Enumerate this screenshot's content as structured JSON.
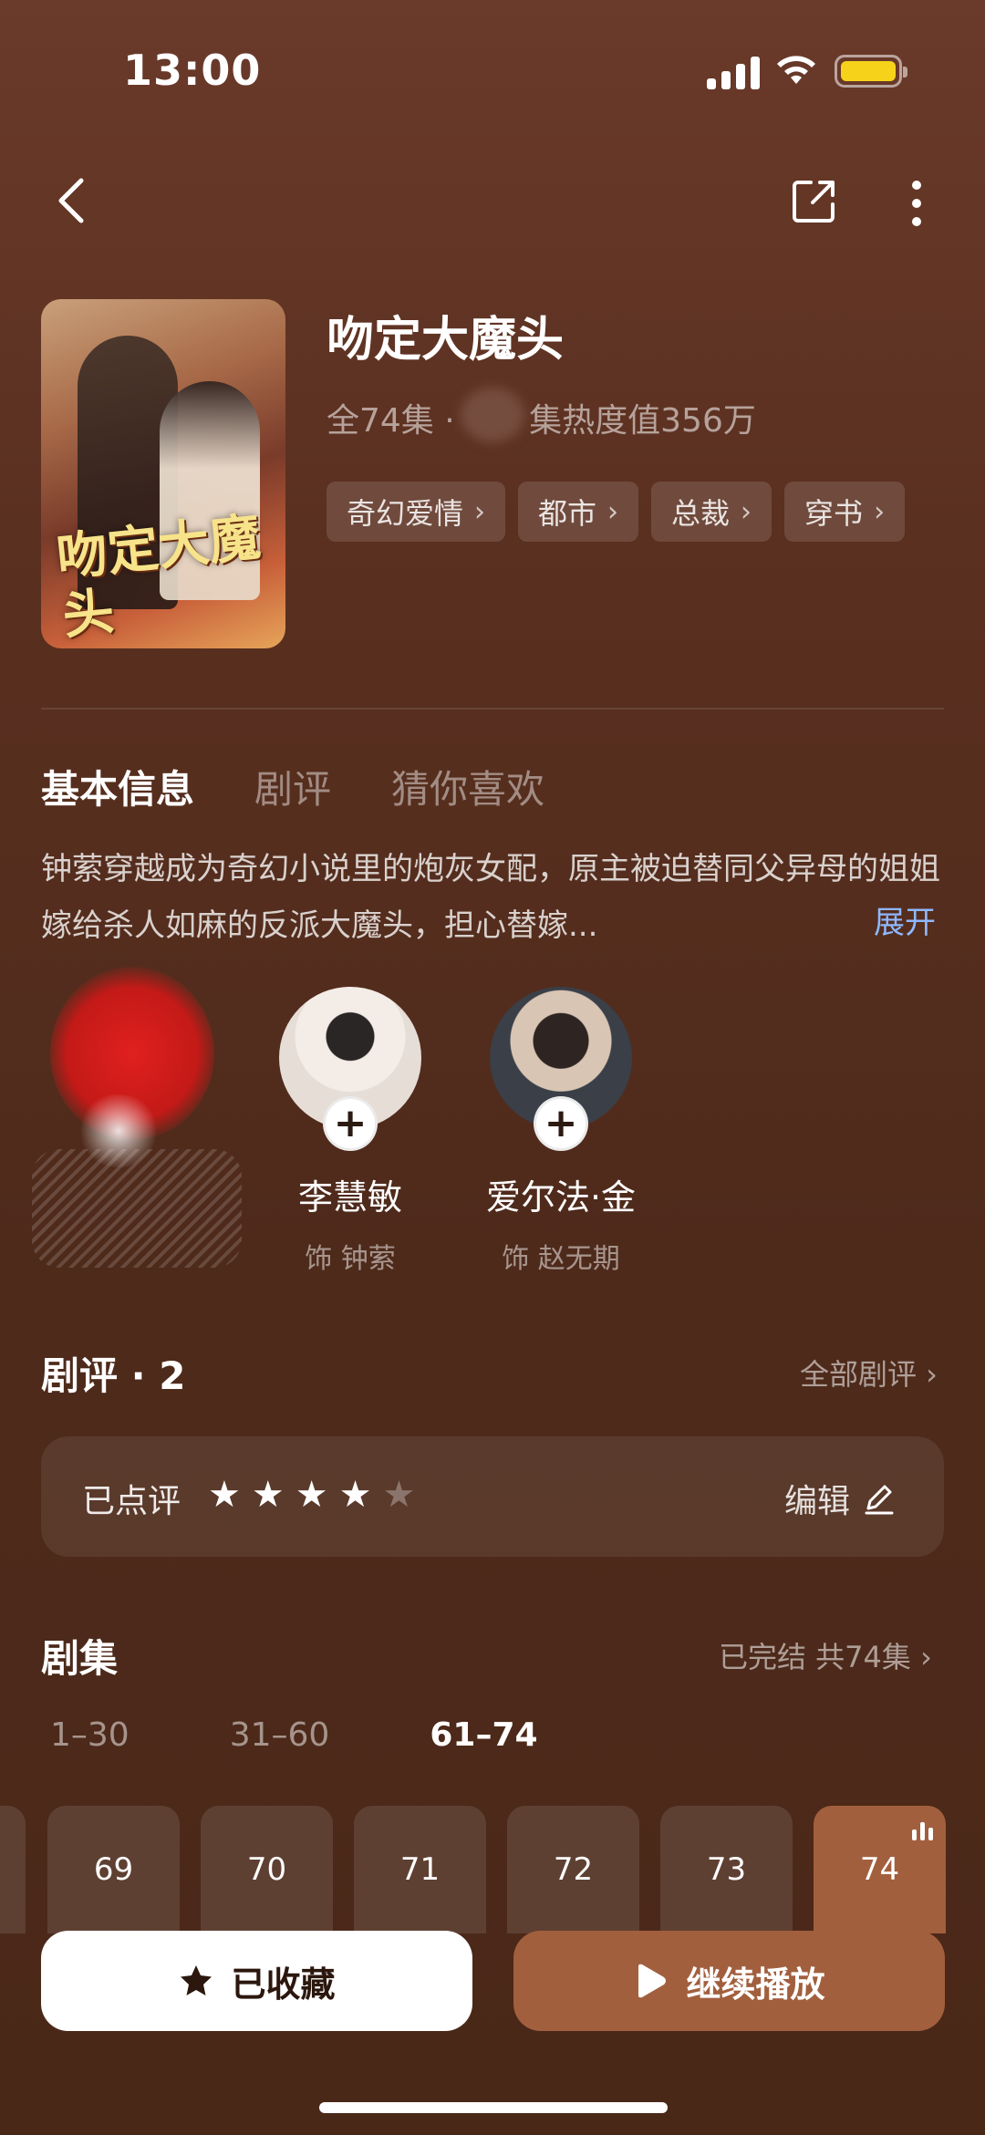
{
  "status_bar": {
    "time": "13:00"
  },
  "show": {
    "title": "吻定大魔头",
    "cover_title": "吻定大魔头",
    "meta": "全74集 · ",
    "meta_heat": "集热度值356万",
    "tags": [
      "奇幻爱情",
      "都市",
      "总裁",
      "穿书"
    ]
  },
  "tabs": [
    {
      "label": "基本信息",
      "active": true
    },
    {
      "label": "剧评",
      "active": false
    },
    {
      "label": "猜你喜欢",
      "active": false
    }
  ],
  "synopsis": {
    "text": "钟萦穿越成为奇幻小说里的炮灰女配，原主被迫替同父异母的姐姐嫁给杀人如麻的反派大魔头，担心替嫁...",
    "expand_label": "展开"
  },
  "cast": [
    {
      "name": "李慧敏",
      "role": "饰 钟萦",
      "follow_icon": "+"
    },
    {
      "name": "爱尔法·金",
      "role": "饰 赵无期",
      "follow_icon": "+"
    }
  ],
  "reviews": {
    "title": "剧评 · 2",
    "all_label": "全部剧评 ›",
    "rated_label": "已点评",
    "rating": 4,
    "max_rating": 5,
    "edit_label": "编辑"
  },
  "episodes": {
    "title": "剧集",
    "status": "已完结 共74集 ›",
    "ranges": [
      {
        "label": "1–30",
        "active": false
      },
      {
        "label": "31–60",
        "active": false
      },
      {
        "label": "61–74",
        "active": true
      }
    ],
    "items": [
      "69",
      "70",
      "71",
      "72",
      "73",
      "74"
    ],
    "current": "74"
  },
  "actions": {
    "favorite_label": "已收藏",
    "play_label": "继续播放"
  },
  "colors": {
    "accent": "#a25f3e",
    "link": "#8fb8ff",
    "star": "#ffffff",
    "battery": "#f6d21b"
  }
}
